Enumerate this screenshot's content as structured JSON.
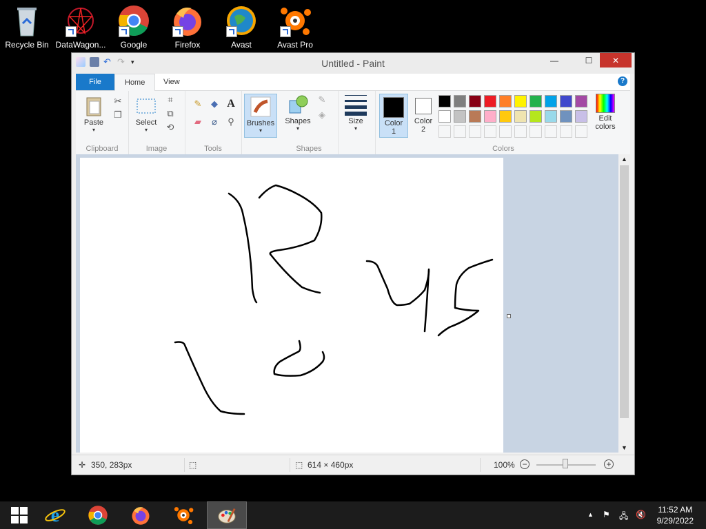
{
  "desktop": {
    "icons": [
      {
        "label": "Recycle Bin"
      },
      {
        "label": "DataWagon..."
      },
      {
        "label": "Google"
      },
      {
        "label": "Firefox"
      },
      {
        "label": "Avast"
      },
      {
        "label": "Avast Pro"
      }
    ]
  },
  "window": {
    "title": "Untitled - Paint",
    "controls": {
      "minimize": "—",
      "maximize": "☐",
      "close": "✕"
    }
  },
  "ribbon": {
    "tabs": {
      "file": "File",
      "home": "Home",
      "view": "View"
    },
    "help": "?",
    "clipboard": {
      "paste": "Paste",
      "group": "Clipboard"
    },
    "image": {
      "select": "Select",
      "group": "Image"
    },
    "tools": {
      "group": "Tools",
      "text_glyph": "A"
    },
    "brushes": {
      "label": "Brushes"
    },
    "shapes": {
      "label": "Shapes",
      "group": "Shapes"
    },
    "size": {
      "label": "Size"
    },
    "colors": {
      "color1_line1": "Color",
      "color1_line2": "1",
      "color2_line1": "Color",
      "color2_line2": "2",
      "edit_line1": "Edit",
      "edit_line2": "colors",
      "group": "Colors",
      "color1": "#000000",
      "color2": "#ffffff",
      "palette_row1": [
        "#000000",
        "#7f7f7f",
        "#880015",
        "#ed1c24",
        "#ff7f27",
        "#fff200",
        "#22b14c",
        "#00a2e8",
        "#3f48cc",
        "#a349a4"
      ],
      "palette_row2": [
        "#ffffff",
        "#c3c3c3",
        "#b97a57",
        "#ffaec9",
        "#ffc90e",
        "#efe4b0",
        "#b5e61d",
        "#99d9ea",
        "#7092be",
        "#c8bfe7"
      ]
    }
  },
  "statusbar": {
    "cursor_pos": "350, 283px",
    "canvas_size": "614 × 460px",
    "zoom": "100%",
    "zoom_minus": "−",
    "zoom_plus": "+"
  },
  "taskbar": {
    "time": "11:52 AM",
    "date": "9/29/2022"
  }
}
